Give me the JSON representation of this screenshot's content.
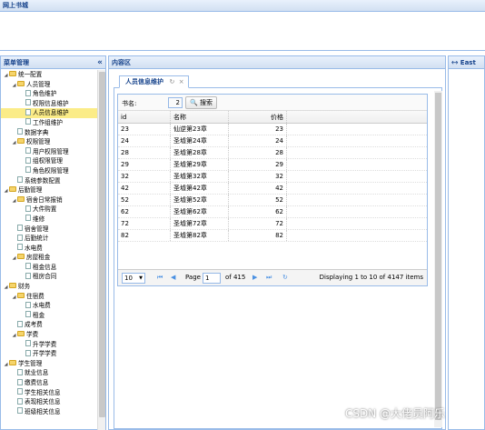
{
  "app_title": "网上书城",
  "west": {
    "title": "菜单管理",
    "collapse": "«",
    "tree": [
      {
        "label": "统一配置",
        "depth": 0,
        "type": "folder",
        "arrow": "◢"
      },
      {
        "label": "人员管理",
        "depth": 1,
        "type": "folder",
        "arrow": "◢"
      },
      {
        "label": "角色维护",
        "depth": 2,
        "type": "file"
      },
      {
        "label": "权限信息维护",
        "depth": 2,
        "type": "file"
      },
      {
        "label": "人员信息维护",
        "depth": 2,
        "type": "file",
        "selected": true
      },
      {
        "label": "工作组维护",
        "depth": 2,
        "type": "file"
      },
      {
        "label": "数据字典",
        "depth": 1,
        "type": "file"
      },
      {
        "label": "权限管理",
        "depth": 1,
        "type": "folder",
        "arrow": "◢"
      },
      {
        "label": "用户权限管理",
        "depth": 2,
        "type": "file"
      },
      {
        "label": "组权限管理",
        "depth": 2,
        "type": "file"
      },
      {
        "label": "角色权限管理",
        "depth": 2,
        "type": "file"
      },
      {
        "label": "系统参数配置",
        "depth": 1,
        "type": "file"
      },
      {
        "label": "后勤管理",
        "depth": 0,
        "type": "folder",
        "arrow": "◢"
      },
      {
        "label": "宿舍日常报销",
        "depth": 1,
        "type": "folder",
        "arrow": "◢"
      },
      {
        "label": "大件购置",
        "depth": 2,
        "type": "file"
      },
      {
        "label": "维修",
        "depth": 2,
        "type": "file"
      },
      {
        "label": "宿舍管理",
        "depth": 1,
        "type": "file"
      },
      {
        "label": "后勤统计",
        "depth": 1,
        "type": "file"
      },
      {
        "label": "水电费",
        "depth": 1,
        "type": "file"
      },
      {
        "label": "房屋租金",
        "depth": 1,
        "type": "folder",
        "arrow": "◢"
      },
      {
        "label": "租金信息",
        "depth": 2,
        "type": "file"
      },
      {
        "label": "租房合同",
        "depth": 2,
        "type": "file"
      },
      {
        "label": "财务",
        "depth": 0,
        "type": "folder",
        "arrow": "◢"
      },
      {
        "label": "住宿费",
        "depth": 1,
        "type": "folder",
        "arrow": "◢"
      },
      {
        "label": "水电费",
        "depth": 2,
        "type": "file"
      },
      {
        "label": "租金",
        "depth": 2,
        "type": "file"
      },
      {
        "label": "成考费",
        "depth": 1,
        "type": "file"
      },
      {
        "label": "学费",
        "depth": 1,
        "type": "folder",
        "arrow": "◢"
      },
      {
        "label": "升学学费",
        "depth": 2,
        "type": "file"
      },
      {
        "label": "开学学费",
        "depth": 2,
        "type": "file"
      },
      {
        "label": "学生管理",
        "depth": 0,
        "type": "folder",
        "arrow": "◢"
      },
      {
        "label": "就业信息",
        "depth": 1,
        "type": "file"
      },
      {
        "label": "缴费信息",
        "depth": 1,
        "type": "file"
      },
      {
        "label": "学生相关信息",
        "depth": 1,
        "type": "file"
      },
      {
        "label": "表现相关信息",
        "depth": 1,
        "type": "file"
      },
      {
        "label": "班级相关信息",
        "depth": 1,
        "type": "file"
      }
    ]
  },
  "center": {
    "title": "内容区",
    "tab_label": "人员信息维护",
    "tab_refresh": "↻",
    "tab_close": "×",
    "search_label": "书名:",
    "search_value": "2",
    "search_button": "搜索",
    "columns": [
      "id",
      "名称",
      "价格"
    ],
    "rows": [
      [
        "23",
        "仙逆第23章",
        "23"
      ],
      [
        "24",
        "圣墟第24章",
        "24"
      ],
      [
        "28",
        "圣墟第28章",
        "28"
      ],
      [
        "29",
        "圣墟第29章",
        "29"
      ],
      [
        "32",
        "圣墟第32章",
        "32"
      ],
      [
        "42",
        "圣墟第42章",
        "42"
      ],
      [
        "52",
        "圣墟第52章",
        "52"
      ],
      [
        "62",
        "圣墟第62章",
        "62"
      ],
      [
        "72",
        "圣墟第72章",
        "72"
      ],
      [
        "82",
        "圣墟第82章",
        "82"
      ]
    ],
    "pager": {
      "page_size": "10",
      "page_label": "Page",
      "page_value": "1",
      "of_label": "of 415",
      "display": "Displaying 1 to 10 of 4147 items"
    }
  },
  "east": {
    "title": "East"
  },
  "watermark": "CSDN @大佬员阿乐"
}
